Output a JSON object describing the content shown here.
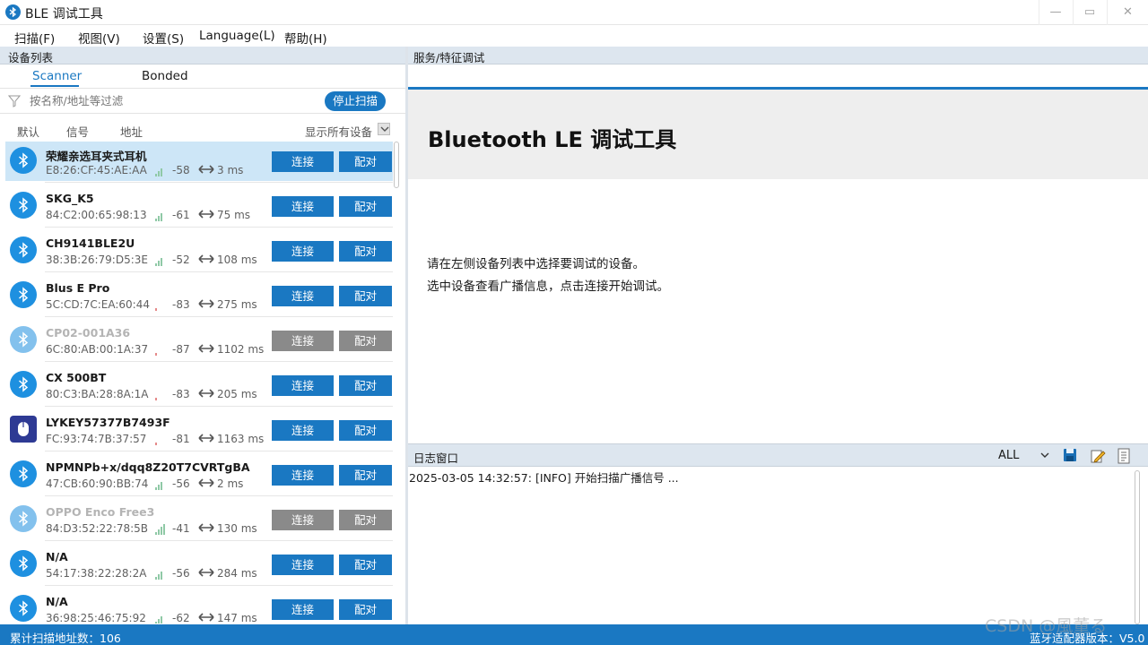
{
  "window": {
    "title": "BLE 调试工具",
    "controls": {
      "minimize": "—",
      "maximize": "▭",
      "close": "✕"
    }
  },
  "menu": [
    "扫描(F)",
    "视图(V)",
    "设置(S)",
    "Language(L)",
    "帮助(H)"
  ],
  "left": {
    "header": "设备列表",
    "tabs": [
      {
        "label": "Scanner",
        "active": true
      },
      {
        "label": "Bonded",
        "active": false
      }
    ],
    "filter_placeholder": "按名称/地址等过滤",
    "stop_scan": "停止扫描",
    "sort": {
      "default": "默认",
      "signal": "信号",
      "address": "地址"
    },
    "show_all": "显示所有设备",
    "connect_label": "连接",
    "pair_label": "配对",
    "devices": [
      {
        "name": "荣耀亲选耳夹式耳机",
        "mac": "E8:26:CF:45:AE:AA",
        "rssi": "-58",
        "rssi_level": 3,
        "interval": "3 ms",
        "icon": "bluetooth-icon",
        "enabled": true,
        "selected": true
      },
      {
        "name": "SKG_K5",
        "mac": "84:C2:00:65:98:13",
        "rssi": "-61",
        "rssi_level": 3,
        "interval": "75 ms",
        "icon": "bluetooth-icon",
        "enabled": true,
        "selected": false
      },
      {
        "name": "CH9141BLE2U",
        "mac": "38:3B:26:79:D5:3E",
        "rssi": "-52",
        "rssi_level": 3,
        "interval": "108 ms",
        "icon": "bluetooth-icon",
        "enabled": true,
        "selected": false
      },
      {
        "name": "Blus E Pro",
        "mac": "5C:CD:7C:EA:60:44",
        "rssi": "-83",
        "rssi_level": 1,
        "interval": "275 ms",
        "icon": "bluetooth-icon",
        "enabled": true,
        "selected": false
      },
      {
        "name": "CP02-001A36",
        "mac": "6C:80:AB:00:1A:37",
        "rssi": "-87",
        "rssi_level": 1,
        "interval": "1102 ms",
        "icon": "bluetooth-icon",
        "enabled": false,
        "selected": false
      },
      {
        "name": "CX 500BT",
        "mac": "80:C3:BA:28:8A:1A",
        "rssi": "-83",
        "rssi_level": 1,
        "interval": "205 ms",
        "icon": "bluetooth-icon",
        "enabled": true,
        "selected": false
      },
      {
        "name": "LYKEY57377B7493F",
        "mac": "FC:93:74:7B:37:57",
        "rssi": "-81",
        "rssi_level": 1,
        "interval": "1163 ms",
        "icon": "mouse-icon",
        "enabled": true,
        "selected": false
      },
      {
        "name": "NPMNPb+x/dqq8Z20T7CVRTgBA",
        "mac": "47:CB:60:90:BB:74",
        "rssi": "-56",
        "rssi_level": 3,
        "interval": "2 ms",
        "icon": "bluetooth-icon",
        "enabled": true,
        "selected": false
      },
      {
        "name": "OPPO Enco Free3",
        "mac": "84:D3:52:22:78:5B",
        "rssi": "-41",
        "rssi_level": 4,
        "interval": "130 ms",
        "icon": "bluetooth-icon",
        "enabled": false,
        "selected": false
      },
      {
        "name": "N/A",
        "mac": "54:17:38:22:28:2A",
        "rssi": "-56",
        "rssi_level": 3,
        "interval": "284 ms",
        "icon": "bluetooth-icon",
        "enabled": true,
        "selected": false
      },
      {
        "name": "N/A",
        "mac": "36:98:25:46:75:92",
        "rssi": "-62",
        "rssi_level": 3,
        "interval": "147 ms",
        "icon": "bluetooth-icon",
        "enabled": true,
        "selected": false
      }
    ]
  },
  "right": {
    "header": "服务/特征调试",
    "hero_title": "Bluetooth LE 调试工具",
    "hint_line1": "请在左侧设备列表中选择要调试的设备。",
    "hint_line2": "选中设备查看广播信息，点击连接开始调试。"
  },
  "log": {
    "title": "日志窗口",
    "level": "ALL",
    "entries": [
      "2025-03-05 14:32:57:  [INFO] 开始扫描广播信号 ..."
    ]
  },
  "status": {
    "left": "累计扫描地址数：106",
    "right": "蓝牙适配器版本：V5.0"
  },
  "watermark": "CSDN @風董る",
  "colors": {
    "accent": "#1a78c2",
    "panel_header": "#dde6ef",
    "signal_good": "#8fc9a6",
    "signal_weak": "#e58a8a",
    "disabled_button": "#8a8a8a"
  }
}
